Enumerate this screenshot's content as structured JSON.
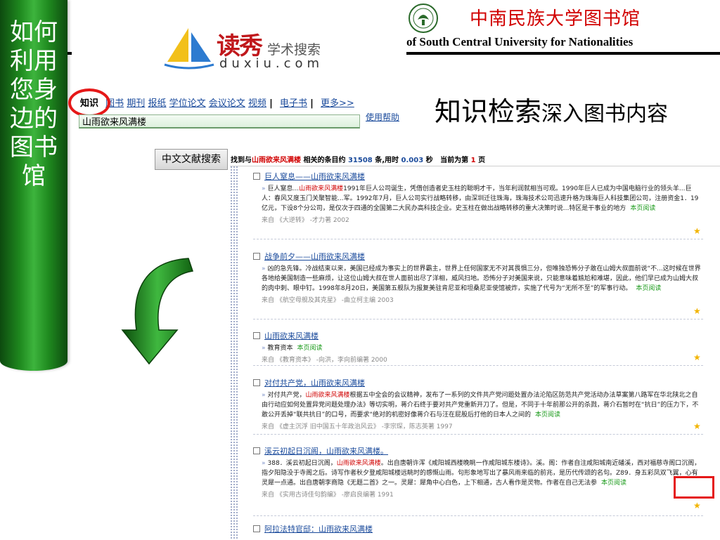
{
  "sidebar": {
    "title": "如何利用您身边的图书馆"
  },
  "library": {
    "name_cn": "中南民族大学图书馆",
    "name_en": "of South Central University for Nationalities",
    "logo_icon": "university-seal-icon"
  },
  "duxiu": {
    "brand": "读秀",
    "subtitle": "学术搜索",
    "domain": "duxiu.com",
    "logo_icon": "sailboat-icon"
  },
  "search": {
    "tabs": [
      {
        "label": "知识",
        "active": true
      },
      {
        "label": "图书",
        "active": false
      },
      {
        "label": "期刊",
        "active": false
      },
      {
        "label": "报纸",
        "active": false
      },
      {
        "label": "学位论文",
        "active": false
      },
      {
        "label": "会议论文",
        "active": false
      },
      {
        "label": "视频",
        "active": false
      },
      {
        "label": "电子书",
        "active": false
      },
      {
        "label": "更多>>",
        "active": false
      }
    ],
    "query": "山雨欲来风满楼",
    "help_label": "使用帮助"
  },
  "tagline": {
    "main": "知识检索",
    "sub": "深入图书内容"
  },
  "results_panel": {
    "category_button": "中文文献搜索",
    "summary_prefix": "找到与",
    "summary_query": "山雨欲来风满楼",
    "summary_mid": "相关的条目约",
    "summary_count": "31508",
    "summary_suffix": "条,用时",
    "summary_time": "0.003",
    "summary_unit": "秒",
    "summary_page_prefix": "当前为第",
    "summary_page": "1",
    "summary_page_suffix": "页"
  },
  "results": [
    {
      "title_pre": "巨人窒息——",
      "title_hl": "山雨欲来风满楼",
      "title_post": "",
      "snippet_pre": "巨人窒息...",
      "snippet_hl": "山雨欲来风满楼",
      "snippet_post": "1991年巨人公司诞生，凭借创造者史玉柱的聪明才干，当年利润就相当可观。1990年巨人已成为中国电脑行业的领头羊...巨人：春风又度玉门关聚智能...军。1992年7月，巨人公司实行战略转移，由深圳迁往珠海，珠海技术公司迅速升格为珠海巨人科技集团公司，注册资金1．19亿元，下设8个分公司，是仅次于四通的全国第二大民办高科技企业。史玉柱在做出战略转移的重大决策时说...特区是干事业的地方",
      "read_label": "本页阅读",
      "source": "来自 《大逆转》 -才力著 2002"
    },
    {
      "title_pre": "战争前夕——",
      "title_hl": "山雨欲来风满楼",
      "title_post": "",
      "snippet_pre": "凶的急先锋。冷战结束以来，美国已经成为事实上的世界霸主，世界上任何国家无不对其畏惧三分，但唯独恐怖分子敢在山姆大叔面前说“不...这时候在世界各地给美国制造一些麻烦，让这位山姆大叔在世人面前出尽了洋相，威风扫地。恐怖分子对美国来说，只能意味着尴尬和难堪，因此，他们早已成为山姆大叔的肉中刺、眼中钉。1998年8月20日，美国第五舰队为报复美驻肯尼亚和坦桑尼亚使馆被炸，实施了代号为“无所不至”的军事行动。",
      "snippet_hl": "",
      "snippet_post": "",
      "read_label": "本页阅读",
      "source": "来自 《航空母舰及其克星》 -曲立柯主编 2003"
    },
    {
      "title_pre": "",
      "title_hl": "山雨欲来风满楼",
      "title_post": "",
      "snippet_pre": "教育资本",
      "snippet_hl": "",
      "snippet_post": "",
      "read_label": "本页阅读",
      "source": "来自 《教育资本》 -向洪，李向前编著 2000"
    },
    {
      "title_pre": "对付共产党，",
      "title_hl": "山雨欲来风满楼",
      "title_post": "",
      "snippet_pre": "对付共产党，",
      "snippet_hl": "山雨欲来风满楼",
      "snippet_post": "根据五中全会的会议精神，发布了一系列的文件共产党问题处置办法沦陷区防范共产党活动办法草案第八路军在华北陕北之自由行动应如何处置异党问题处理办法》等切实明，蒋介石终于要对共产党重新开刀了。但是，不同于十年前那公开的杀戮，蒋介石暂时在“抗日”的压力下，不敢公开丢掉“联共抗日”的口号，而要求“绝对的机密好像蒋介石与汪在屁股后打他的日本人之间的",
      "read_label": "本页阅读",
      "source": "来自 《虚主沉浮 旧中国五十年政治风云》 -李宗琛，陈志英著 1997"
    },
    {
      "title_pre": "溪云初起日沉阁，",
      "title_hl": "山雨欲来风满楼",
      "title_post": "。",
      "snippet_pre": "388．溪云初起日沉阁，",
      "snippet_hl": "山雨欲来风满楼",
      "snippet_post": "。出自唐朝许浑《咸阳城西楼晚眺一作咸阳城东楼诗》。溪。阁：作者自注咸阳城南近磻溪，西对福慈寺阁口沉阁，指夕阳隐没于寺阁之后。诗写作者秋夕登咸阳城楼远眺时的感慨山雨。句形象地写出了暴风雨来临的前兆，是历代传颂的名句。Z89．身五彩凤双飞翼，心有灵犀一点通。出自唐朝李商隐《无题二首》之一。灵犀：犀角中心白色，上下相通，古人看作是灵物。作者在自己无法参",
      "read_label": "本页阅读",
      "source": "来自 《实用古诗佳句韵编》 -廖启良编著 1991"
    },
    {
      "title_pre": "阿拉法特官邸：",
      "title_hl": "山雨欲来风满楼",
      "title_post": "",
      "snippet_pre": "",
      "snippet_hl": "",
      "snippet_post": "",
      "read_label": "",
      "source": ""
    }
  ],
  "colors": {
    "sidebar_green": "#1f8a1f",
    "library_red": "#d10000",
    "link_blue": "#1b4b9c",
    "highlight_red": "#d10000",
    "annotation_red": "#e51818",
    "arrow_green": "#2e9a2e"
  },
  "icons": {
    "checkbox": "checkbox-icon",
    "star": "star-icon",
    "arrow": "curved-down-arrow-icon"
  }
}
